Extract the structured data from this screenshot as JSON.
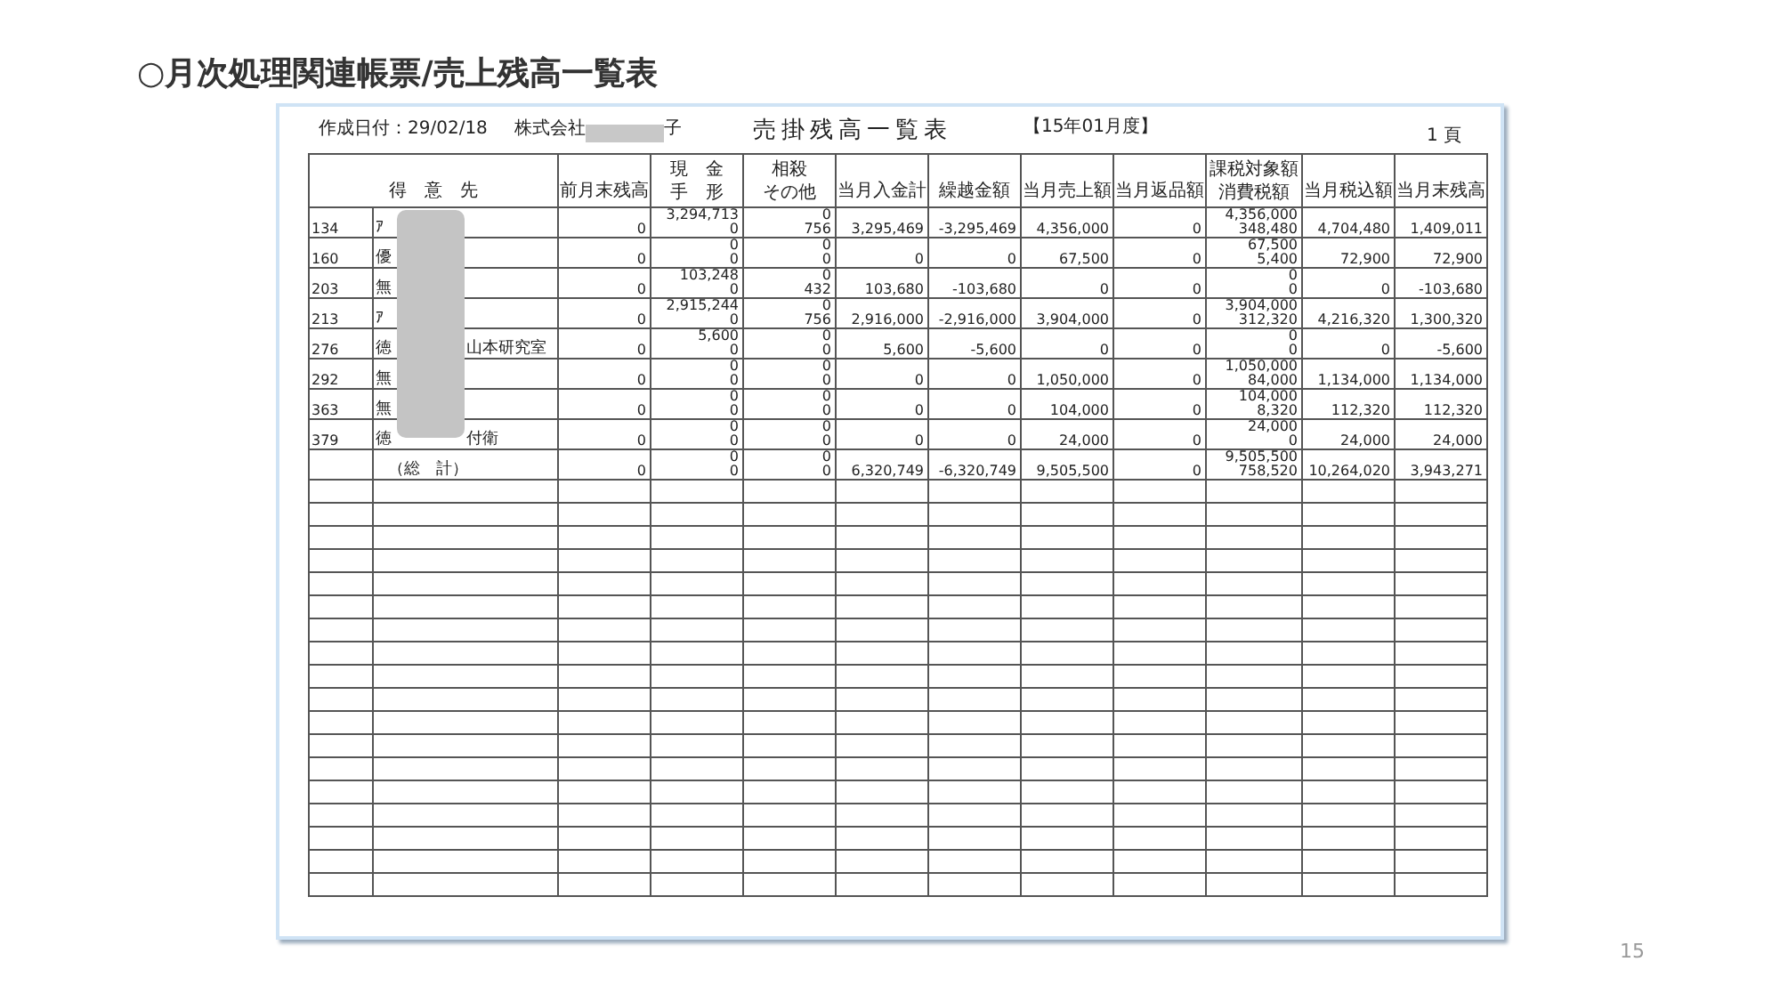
{
  "slide_title": "○月次処理関連帳票/売上残高一覧表",
  "report": {
    "created_label": "作成日付：29/02/18",
    "company_start": "株式会社",
    "company_end": "子",
    "title": "売掛残高一覧表",
    "period": "【15年01月度】",
    "page": "1 頁",
    "customer_header": "得　意　先",
    "columns": [
      {
        "lines": [
          "前月末残高"
        ]
      },
      {
        "lines": [
          "現　金",
          "手　形"
        ]
      },
      {
        "lines": [
          "相殺",
          "その他"
        ]
      },
      {
        "lines": [
          "当月入金計"
        ]
      },
      {
        "lines": [
          "繰越金額"
        ]
      },
      {
        "lines": [
          "当月売上額"
        ]
      },
      {
        "lines": [
          "当月返品額"
        ]
      },
      {
        "lines": [
          "課税対象額",
          "消費税額"
        ]
      },
      {
        "lines": [
          "当月税込額"
        ]
      },
      {
        "lines": [
          "当月末残高"
        ]
      }
    ],
    "rows": [
      {
        "code": "134",
        "name": "ｱ",
        "name_end": "",
        "cells": [
          [
            "0"
          ],
          [
            "3,294,713",
            "0"
          ],
          [
            "0",
            "756"
          ],
          [
            "3,295,469"
          ],
          [
            "-3,295,469"
          ],
          [
            "4,356,000"
          ],
          [
            "0"
          ],
          [
            "4,356,000",
            "348,480"
          ],
          [
            "4,704,480"
          ],
          [
            "1,409,011"
          ]
        ]
      },
      {
        "code": "160",
        "name": "優",
        "name_end": "",
        "cells": [
          [
            "0"
          ],
          [
            "0",
            "0"
          ],
          [
            "0",
            "0"
          ],
          [
            "0"
          ],
          [
            "0"
          ],
          [
            "67,500"
          ],
          [
            "0"
          ],
          [
            "67,500",
            "5,400"
          ],
          [
            "72,900"
          ],
          [
            "72,900"
          ]
        ]
      },
      {
        "code": "203",
        "name": "無",
        "name_end": "",
        "cells": [
          [
            "0"
          ],
          [
            "103,248",
            "0"
          ],
          [
            "0",
            "432"
          ],
          [
            "103,680"
          ],
          [
            "-103,680"
          ],
          [
            "0"
          ],
          [
            "0"
          ],
          [
            "0",
            "0"
          ],
          [
            "0"
          ],
          [
            "-103,680"
          ]
        ]
      },
      {
        "code": "213",
        "name": "ｱ",
        "name_end": "",
        "cells": [
          [
            "0"
          ],
          [
            "2,915,244",
            "0"
          ],
          [
            "0",
            "756"
          ],
          [
            "2,916,000"
          ],
          [
            "-2,916,000"
          ],
          [
            "3,904,000"
          ],
          [
            "0"
          ],
          [
            "3,904,000",
            "312,320"
          ],
          [
            "4,216,320"
          ],
          [
            "1,300,320"
          ]
        ]
      },
      {
        "code": "276",
        "name": "徳",
        "name_end": "山本研究室",
        "cells": [
          [
            "0"
          ],
          [
            "5,600",
            "0"
          ],
          [
            "0",
            "0"
          ],
          [
            "5,600"
          ],
          [
            "-5,600"
          ],
          [
            "0"
          ],
          [
            "0"
          ],
          [
            "0",
            "0"
          ],
          [
            "0"
          ],
          [
            "-5,600"
          ]
        ]
      },
      {
        "code": "292",
        "name": "無",
        "name_end": "",
        "cells": [
          [
            "0"
          ],
          [
            "0",
            "0"
          ],
          [
            "0",
            "0"
          ],
          [
            "0"
          ],
          [
            "0"
          ],
          [
            "1,050,000"
          ],
          [
            "0"
          ],
          [
            "1,050,000",
            "84,000"
          ],
          [
            "1,134,000"
          ],
          [
            "1,134,000"
          ]
        ]
      },
      {
        "code": "363",
        "name": "無",
        "name_end": "",
        "cells": [
          [
            "0"
          ],
          [
            "0",
            "0"
          ],
          [
            "0",
            "0"
          ],
          [
            "0"
          ],
          [
            "0"
          ],
          [
            "104,000"
          ],
          [
            "0"
          ],
          [
            "104,000",
            "8,320"
          ],
          [
            "112,320"
          ],
          [
            "112,320"
          ]
        ]
      },
      {
        "code": "379",
        "name": "徳",
        "name_end": "付衛",
        "cells": [
          [
            "0"
          ],
          [
            "0",
            "0"
          ],
          [
            "0",
            "0"
          ],
          [
            "0"
          ],
          [
            "0"
          ],
          [
            "24,000"
          ],
          [
            "0"
          ],
          [
            "24,000",
            "0"
          ],
          [
            "24,000"
          ],
          [
            "24,000"
          ]
        ]
      }
    ],
    "total": {
      "label": "（総　計）",
      "cells": [
        [
          "0"
        ],
        [
          "0",
          "0"
        ],
        [
          "0",
          "0"
        ],
        [
          "6,320,749"
        ],
        [
          "-6,320,749"
        ],
        [
          "9,505,500"
        ],
        [
          "0"
        ],
        [
          "9,505,500",
          "758,520"
        ],
        [
          "10,264,020"
        ],
        [
          "3,943,271"
        ]
      ]
    }
  },
  "page_number": "15"
}
